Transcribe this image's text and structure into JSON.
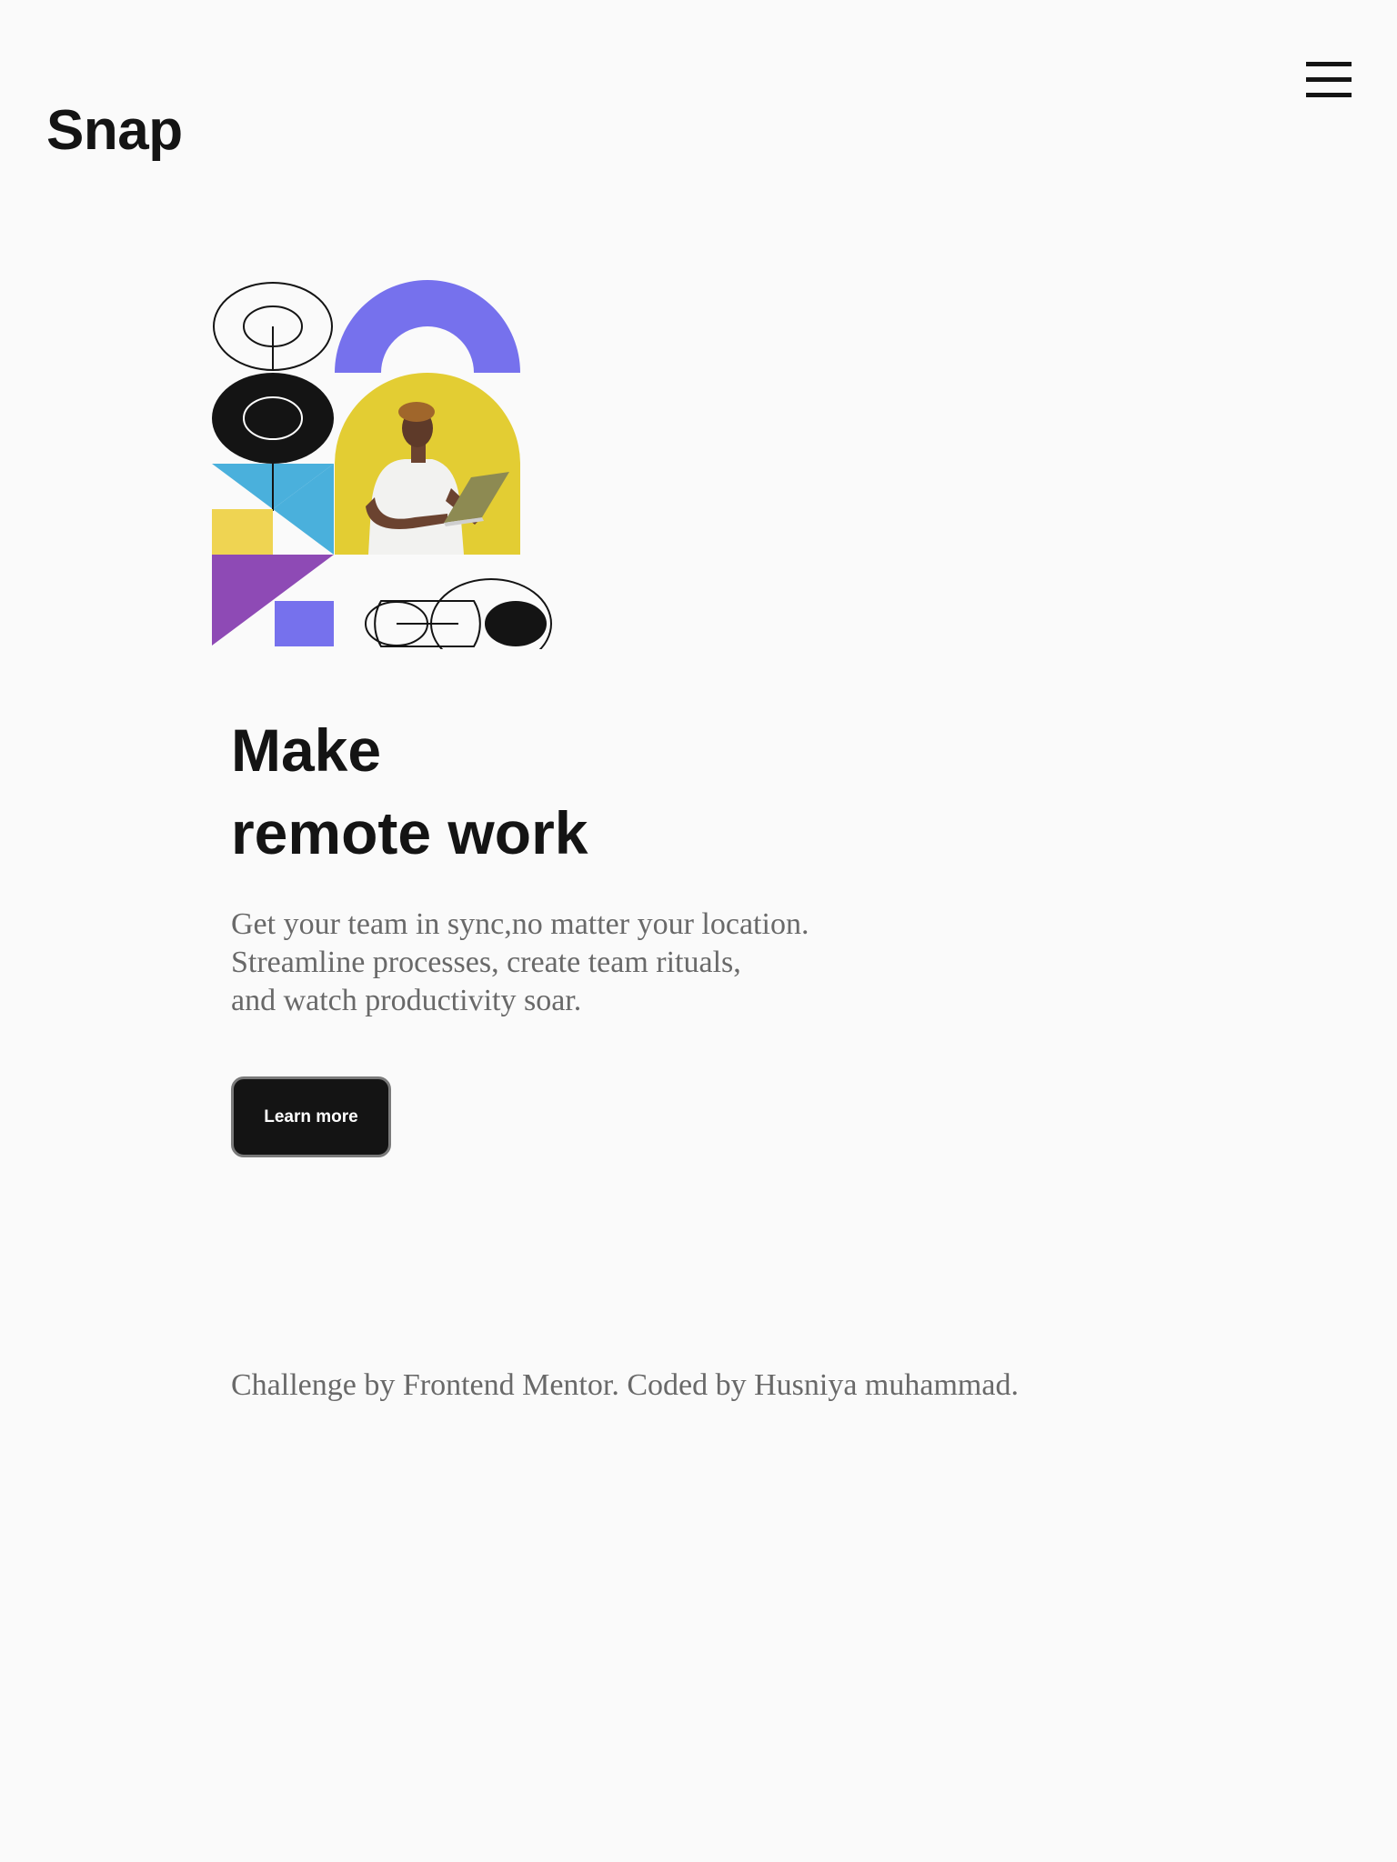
{
  "header": {
    "logo": "Snap",
    "menu_icon": "hamburger-menu-icon"
  },
  "hero": {
    "illustration": {
      "description_icon": "abstract-shapes-with-person-on-laptop",
      "colors": {
        "purple": "#7671ED",
        "yellow": "#E3CD33",
        "yellow_light": "#EFD452",
        "blue": "#4AB0DC",
        "violet": "#8E4AB5",
        "black": "#141414"
      }
    },
    "headline_line1": "Make",
    "headline_line2": "remote work",
    "intro_line1": "Get your team in sync,no matter your location.",
    "intro_line2": "Streamline processes, create team rituals,",
    "intro_line3": "and watch productivity soar.",
    "cta_label": "Learn more"
  },
  "footer": {
    "attribution": "Challenge by Frontend Mentor. Coded by Husniya muhammad."
  },
  "theme": {
    "background": "#FAFAFA",
    "text_dark": "#141414",
    "text_muted": "#696969"
  }
}
